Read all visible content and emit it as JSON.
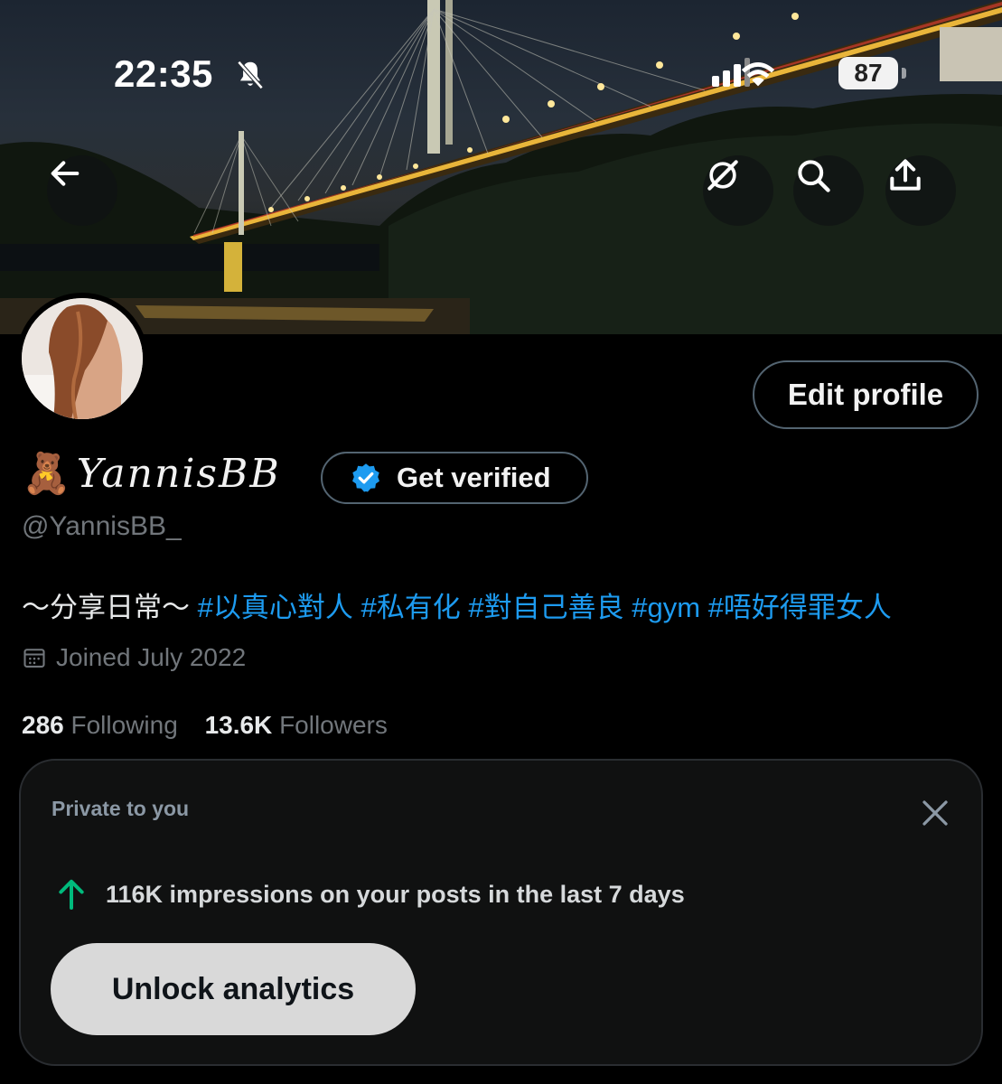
{
  "status_bar": {
    "time": "22:35",
    "battery": "87"
  },
  "header": {
    "back_icon": "back-arrow-icon",
    "buttons": [
      "grok-icon",
      "search-icon",
      "share-icon"
    ]
  },
  "profile": {
    "emoji": "🧸",
    "display_name": "YannisBB",
    "handle": "@YannisBB_",
    "edit_label": "Edit profile",
    "verify_label": "Get verified",
    "bio_text": "～分享日常～",
    "bio_tags": [
      "#以真心對人",
      "#私有化",
      "#對自己善良",
      "#gym",
      "#唔好得罪女人"
    ],
    "joined": "Joined July 2022",
    "following_count": "286",
    "following_label": "Following",
    "followers_count": "13.6K",
    "followers_label": "Followers"
  },
  "analytics_card": {
    "private_label": "Private to you",
    "impressions_text": "116K impressions on your posts in the last 7 days",
    "unlock_label": "Unlock analytics"
  },
  "colors": {
    "accent": "#1d9bf0",
    "growth": "#00ba7c",
    "muted": "#71767b"
  }
}
